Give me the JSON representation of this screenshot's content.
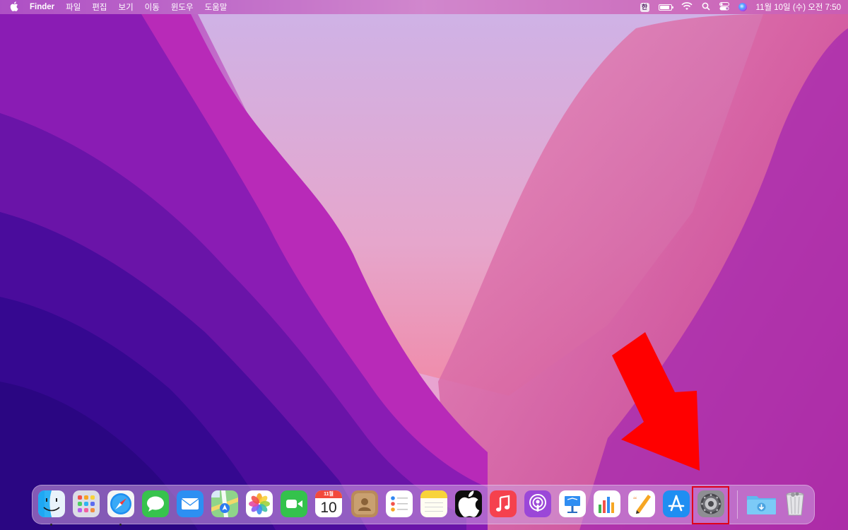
{
  "menubar": {
    "apple_icon": "apple-logo-icon",
    "app_name": "Finder",
    "menus": [
      "파일",
      "편집",
      "보기",
      "이동",
      "윈도우",
      "도움말"
    ],
    "input_method": "한",
    "status_icons": [
      "battery-icon",
      "wifi-icon",
      "spotlight-search-icon",
      "control-center-icon",
      "siri-icon"
    ],
    "clock": "11월 10일 (수) 오전 7:50"
  },
  "dock": {
    "apps": [
      {
        "name": "Finder",
        "icon": "finder-icon",
        "running": true
      },
      {
        "name": "Launchpad",
        "icon": "launchpad-icon",
        "running": false
      },
      {
        "name": "Safari",
        "icon": "safari-icon",
        "running": true
      },
      {
        "name": "Messages",
        "icon": "messages-icon",
        "running": false
      },
      {
        "name": "Mail",
        "icon": "mail-icon",
        "running": false
      },
      {
        "name": "Maps",
        "icon": "maps-icon",
        "running": false
      },
      {
        "name": "Photos",
        "icon": "photos-icon",
        "running": false
      },
      {
        "name": "FaceTime",
        "icon": "facetime-icon",
        "running": false
      },
      {
        "name": "Calendar",
        "icon": "calendar-icon",
        "running": false
      },
      {
        "name": "Contacts",
        "icon": "contacts-icon",
        "running": false
      },
      {
        "name": "Reminders",
        "icon": "reminders-icon",
        "running": false
      },
      {
        "name": "Notes",
        "icon": "notes-icon",
        "running": false
      },
      {
        "name": "TV",
        "icon": "apple-tv-icon",
        "running": false
      },
      {
        "name": "Music",
        "icon": "music-icon",
        "running": false
      },
      {
        "name": "Podcasts",
        "icon": "podcasts-icon",
        "running": false
      },
      {
        "name": "Keynote",
        "icon": "keynote-icon",
        "running": false
      },
      {
        "name": "Numbers",
        "icon": "numbers-icon",
        "running": false
      },
      {
        "name": "Pages",
        "icon": "pages-icon",
        "running": false
      },
      {
        "name": "App Store",
        "icon": "app-store-icon",
        "running": false
      },
      {
        "name": "System Preferences",
        "icon": "system-preferences-icon",
        "running": false,
        "highlighted": true
      }
    ],
    "calendar": {
      "month": "11월",
      "day": "10"
    },
    "tv_label": "tv",
    "downloads_icon": "downloads-folder-icon",
    "trash_icon": "trash-icon"
  },
  "annotation": {
    "arrow_color": "#ff0000",
    "highlight_color": "#e0001a"
  },
  "colors": {
    "wallpaper_dark": "#3a0a8c",
    "wallpaper_mid": "#9b1fc0",
    "wallpaper_light": "#f0a0c8"
  }
}
